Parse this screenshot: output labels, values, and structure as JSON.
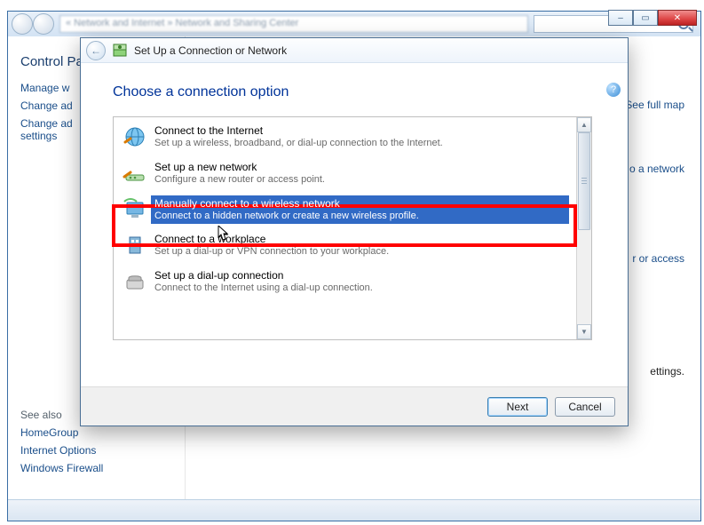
{
  "bg": {
    "address": "« Network and Internet  »  Network and Sharing Center",
    "sidebar": {
      "title": "Control Pa",
      "links": [
        "Manage w",
        "Change ad",
        "Change ad\nsettings"
      ],
      "seealso_label": "See also",
      "seealso_links": [
        "HomeGroup",
        "Internet Options",
        "Windows Firewall"
      ]
    },
    "rightlinks": {
      "map": "See full map",
      "to_network": "o a network",
      "access": "r or access",
      "settings": "ettings."
    }
  },
  "sysbuttons": {
    "min": "–",
    "max": "▭",
    "close": "✕"
  },
  "wizard": {
    "title": "Set Up a Connection or Network",
    "heading": "Choose a connection option",
    "help": "?",
    "options": [
      {
        "title": "Connect to the Internet",
        "desc": "Set up a wireless, broadband, or dial-up connection to the Internet."
      },
      {
        "title": "Set up a new network",
        "desc": "Configure a new router or access point."
      },
      {
        "title": "Manually connect to a wireless network",
        "desc": "Connect to a hidden network or create a new wireless profile."
      },
      {
        "title": "Connect to a workplace",
        "desc": "Set up a dial-up or VPN connection to your workplace."
      },
      {
        "title": "Set up a dial-up connection",
        "desc": "Connect to the Internet using a dial-up connection."
      }
    ],
    "selected_index": 2,
    "buttons": {
      "next": "Next",
      "cancel": "Cancel"
    }
  }
}
